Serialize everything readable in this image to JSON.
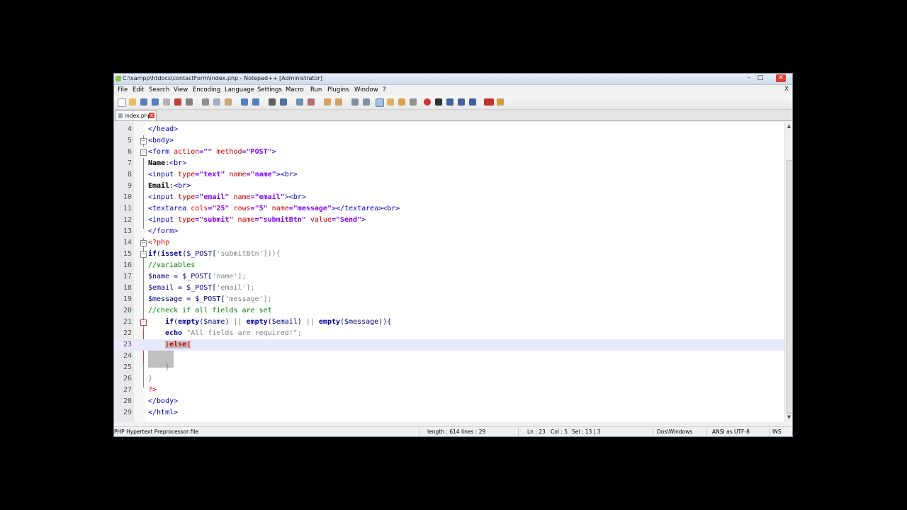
{
  "window": {
    "title": "C:\\xampp\\htdocs\\contactForm\\index.php - Notepad++ [Administrator]",
    "minimize": "–",
    "maximize": "□",
    "close": "✕"
  },
  "menu": [
    "File",
    "Edit",
    "Search",
    "View",
    "Encoding",
    "Language",
    "Settings",
    "Macro",
    "Run",
    "Plugins",
    "Window",
    "?"
  ],
  "menu_close": "X",
  "tab": {
    "label": "index.php",
    "close": "x"
  },
  "editor": {
    "current_line": 23,
    "lines": [
      {
        "num": "4"
      },
      {
        "num": "5"
      },
      {
        "num": "6"
      },
      {
        "num": "7"
      },
      {
        "num": "8"
      },
      {
        "num": "9"
      },
      {
        "num": "10"
      },
      {
        "num": "11"
      },
      {
        "num": "12"
      },
      {
        "num": "13"
      },
      {
        "num": "14"
      },
      {
        "num": "15"
      },
      {
        "num": "16"
      },
      {
        "num": "17"
      },
      {
        "num": "18"
      },
      {
        "num": "19"
      },
      {
        "num": "20"
      },
      {
        "num": "21"
      },
      {
        "num": "22"
      },
      {
        "num": "23"
      },
      {
        "num": "24"
      },
      {
        "num": "25"
      },
      {
        "num": "26"
      },
      {
        "num": "27"
      },
      {
        "num": "28"
      },
      {
        "num": "29"
      }
    ],
    "code": {
      "l4": "</head>",
      "l5": "<body>",
      "l6_tag": "<form",
      "l6_attr1": "action",
      "l6_eq1": "=",
      "l6_val1": "\"\"",
      "l6_attr2": "method",
      "l6_eq2": "=",
      "l6_val2": "\"POST\"",
      "l6_close": ">",
      "l7_text": "Name",
      "l7_rest": ":<br>",
      "l8_tag": "<input",
      "l8_attr1": "type",
      "l8_val1": "=\"text\"",
      "l8_attr2": "name",
      "l8_val2": "=\"name\"",
      "l8_close": "><br>",
      "l9_text": "Email",
      "l9_rest": ":<br>",
      "l10_tag": "<input",
      "l10_attr1": "type",
      "l10_val1": "=\"email\"",
      "l10_attr2": "name",
      "l10_val2": "=\"email\"",
      "l10_close": "><br>",
      "l11_tag": "<textarea",
      "l11_attr1": "cols",
      "l11_val1": "=\"25\"",
      "l11_attr2": "rows",
      "l11_val2": "=\"5\"",
      "l11_attr3": "name",
      "l11_val3": "=\"message\"",
      "l11_close": "></textarea><br>",
      "l12_tag": "<input",
      "l12_attr1": "type",
      "l12_val1": "=\"submit\"",
      "l12_attr2": "name",
      "l12_val2": "=\"submitBtn\"",
      "l12_attr3": "value",
      "l12_val3": "=\"Send\"",
      "l12_close": ">",
      "l13": "</form>",
      "l14": "<?php",
      "l15_kw1": "if",
      "l15_p1": "(",
      "l15_kw2": "isset",
      "l15_p2": "($_POST[",
      "l15_str": "'submitBtn'",
      "l15_p3": "])){",
      "l16": "//variables",
      "l17_var": "$name",
      "l17_p1": " = $_POST[",
      "l17_str": "'name'",
      "l17_p2": "];",
      "l18_var": "$email",
      "l18_p1": " = $_POST[",
      "l18_str": "'email'",
      "l18_p2": "];",
      "l19_var": "$message",
      "l19_p1": " = $_POST[",
      "l19_str": "'message'",
      "l19_p2": "];",
      "l20": "//check if all fields are set",
      "l21_kw1": "if",
      "l21_p1": "(",
      "l21_kw2": "empty",
      "l21_p2": "($name)",
      "l21_op1": " || ",
      "l21_kw3": "empty",
      "l21_p3": "($email)",
      "l21_op2": " || ",
      "l21_kw4": "empty",
      "l21_p4": "($message)){",
      "l22_kw": "echo",
      "l22_str": " \"All fields are required!\"",
      "l22_p": ";",
      "l23_brace": "}",
      "l23_kw": "else",
      "l23_open": "{",
      "l25": "}",
      "l26": "}",
      "l27": "?>",
      "l28": "</body>",
      "l29": "</html>"
    }
  },
  "status": {
    "file_type": "PHP Hypertext Preprocessor file",
    "length": "length : 614",
    "lines": "lines : 29",
    "position": "Ln : 23",
    "col": "Col : 5",
    "sel": "Sel : 13 | 3",
    "eol": "Dos\\Windows",
    "encoding": "ANSI as UTF-8",
    "mode": "INS"
  }
}
